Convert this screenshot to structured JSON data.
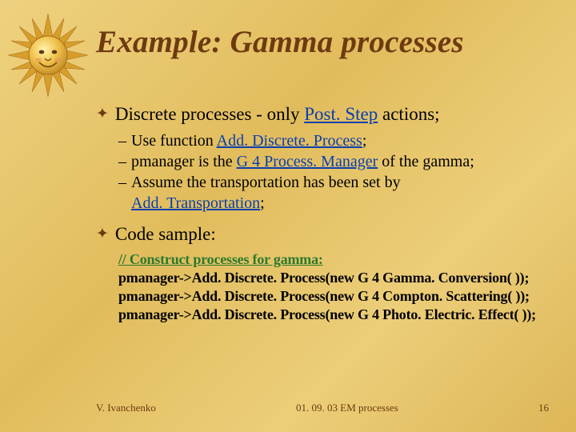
{
  "title": "Example: Gamma processes",
  "bullets": {
    "b1_pre": "Discrete processes - only ",
    "b1_link": "Post. Step",
    "b1_post": " actions;",
    "subs": {
      "s1_pre": "Use function ",
      "s1_link": "Add. Discrete. Process",
      "s1_post": ";",
      "s2_pre": "pmanager is the ",
      "s2_link": "G 4 Process. Manager",
      "s2_post": " of the gamma;",
      "s3a": "Assume the transportation has been set by",
      "s3b_link": "Add. Transportation",
      "s3b_post": ";"
    },
    "b2": "Code sample:"
  },
  "code": {
    "c1": "// Construct processes for gamma:",
    "c2": "pmanager->Add. Discrete. Process(new G 4 Gamma. Conversion( ));",
    "c3": "pmanager->Add. Discrete. Process(new G 4 Compton. Scattering( ));",
    "c4": "pmanager->Add. Discrete. Process(new G 4 Photo. Electric. Effect( ));"
  },
  "footer": {
    "left": "V. Ivanchenko",
    "center": "01. 09. 03 EM processes",
    "right": "16"
  }
}
